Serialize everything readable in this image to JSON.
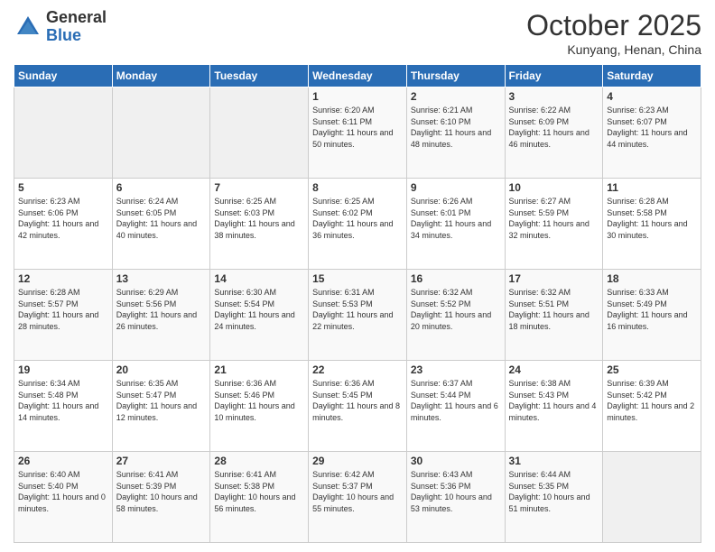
{
  "logo": {
    "general": "General",
    "blue": "Blue"
  },
  "header": {
    "month": "October 2025",
    "location": "Kunyang, Henan, China"
  },
  "weekdays": [
    "Sunday",
    "Monday",
    "Tuesday",
    "Wednesday",
    "Thursday",
    "Friday",
    "Saturday"
  ],
  "weeks": [
    [
      {
        "day": "",
        "empty": true
      },
      {
        "day": "",
        "empty": true
      },
      {
        "day": "",
        "empty": true
      },
      {
        "day": "1",
        "sunrise": "6:20 AM",
        "sunset": "6:11 PM",
        "daylight": "11 hours and 50 minutes."
      },
      {
        "day": "2",
        "sunrise": "6:21 AM",
        "sunset": "6:10 PM",
        "daylight": "11 hours and 48 minutes."
      },
      {
        "day": "3",
        "sunrise": "6:22 AM",
        "sunset": "6:09 PM",
        "daylight": "11 hours and 46 minutes."
      },
      {
        "day": "4",
        "sunrise": "6:23 AM",
        "sunset": "6:07 PM",
        "daylight": "11 hours and 44 minutes."
      }
    ],
    [
      {
        "day": "5",
        "sunrise": "6:23 AM",
        "sunset": "6:06 PM",
        "daylight": "11 hours and 42 minutes."
      },
      {
        "day": "6",
        "sunrise": "6:24 AM",
        "sunset": "6:05 PM",
        "daylight": "11 hours and 40 minutes."
      },
      {
        "day": "7",
        "sunrise": "6:25 AM",
        "sunset": "6:03 PM",
        "daylight": "11 hours and 38 minutes."
      },
      {
        "day": "8",
        "sunrise": "6:25 AM",
        "sunset": "6:02 PM",
        "daylight": "11 hours and 36 minutes."
      },
      {
        "day": "9",
        "sunrise": "6:26 AM",
        "sunset": "6:01 PM",
        "daylight": "11 hours and 34 minutes."
      },
      {
        "day": "10",
        "sunrise": "6:27 AM",
        "sunset": "5:59 PM",
        "daylight": "11 hours and 32 minutes."
      },
      {
        "day": "11",
        "sunrise": "6:28 AM",
        "sunset": "5:58 PM",
        "daylight": "11 hours and 30 minutes."
      }
    ],
    [
      {
        "day": "12",
        "sunrise": "6:28 AM",
        "sunset": "5:57 PM",
        "daylight": "11 hours and 28 minutes."
      },
      {
        "day": "13",
        "sunrise": "6:29 AM",
        "sunset": "5:56 PM",
        "daylight": "11 hours and 26 minutes."
      },
      {
        "day": "14",
        "sunrise": "6:30 AM",
        "sunset": "5:54 PM",
        "daylight": "11 hours and 24 minutes."
      },
      {
        "day": "15",
        "sunrise": "6:31 AM",
        "sunset": "5:53 PM",
        "daylight": "11 hours and 22 minutes."
      },
      {
        "day": "16",
        "sunrise": "6:32 AM",
        "sunset": "5:52 PM",
        "daylight": "11 hours and 20 minutes."
      },
      {
        "day": "17",
        "sunrise": "6:32 AM",
        "sunset": "5:51 PM",
        "daylight": "11 hours and 18 minutes."
      },
      {
        "day": "18",
        "sunrise": "6:33 AM",
        "sunset": "5:49 PM",
        "daylight": "11 hours and 16 minutes."
      }
    ],
    [
      {
        "day": "19",
        "sunrise": "6:34 AM",
        "sunset": "5:48 PM",
        "daylight": "11 hours and 14 minutes."
      },
      {
        "day": "20",
        "sunrise": "6:35 AM",
        "sunset": "5:47 PM",
        "daylight": "11 hours and 12 minutes."
      },
      {
        "day": "21",
        "sunrise": "6:36 AM",
        "sunset": "5:46 PM",
        "daylight": "11 hours and 10 minutes."
      },
      {
        "day": "22",
        "sunrise": "6:36 AM",
        "sunset": "5:45 PM",
        "daylight": "11 hours and 8 minutes."
      },
      {
        "day": "23",
        "sunrise": "6:37 AM",
        "sunset": "5:44 PM",
        "daylight": "11 hours and 6 minutes."
      },
      {
        "day": "24",
        "sunrise": "6:38 AM",
        "sunset": "5:43 PM",
        "daylight": "11 hours and 4 minutes."
      },
      {
        "day": "25",
        "sunrise": "6:39 AM",
        "sunset": "5:42 PM",
        "daylight": "11 hours and 2 minutes."
      }
    ],
    [
      {
        "day": "26",
        "sunrise": "6:40 AM",
        "sunset": "5:40 PM",
        "daylight": "11 hours and 0 minutes."
      },
      {
        "day": "27",
        "sunrise": "6:41 AM",
        "sunset": "5:39 PM",
        "daylight": "10 hours and 58 minutes."
      },
      {
        "day": "28",
        "sunrise": "6:41 AM",
        "sunset": "5:38 PM",
        "daylight": "10 hours and 56 minutes."
      },
      {
        "day": "29",
        "sunrise": "6:42 AM",
        "sunset": "5:37 PM",
        "daylight": "10 hours and 55 minutes."
      },
      {
        "day": "30",
        "sunrise": "6:43 AM",
        "sunset": "5:36 PM",
        "daylight": "10 hours and 53 minutes."
      },
      {
        "day": "31",
        "sunrise": "6:44 AM",
        "sunset": "5:35 PM",
        "daylight": "10 hours and 51 minutes."
      },
      {
        "day": "",
        "empty": true
      }
    ]
  ],
  "labels": {
    "sunrise_prefix": "Sunrise: ",
    "sunset_prefix": "Sunset: ",
    "daylight_prefix": "Daylight: "
  }
}
